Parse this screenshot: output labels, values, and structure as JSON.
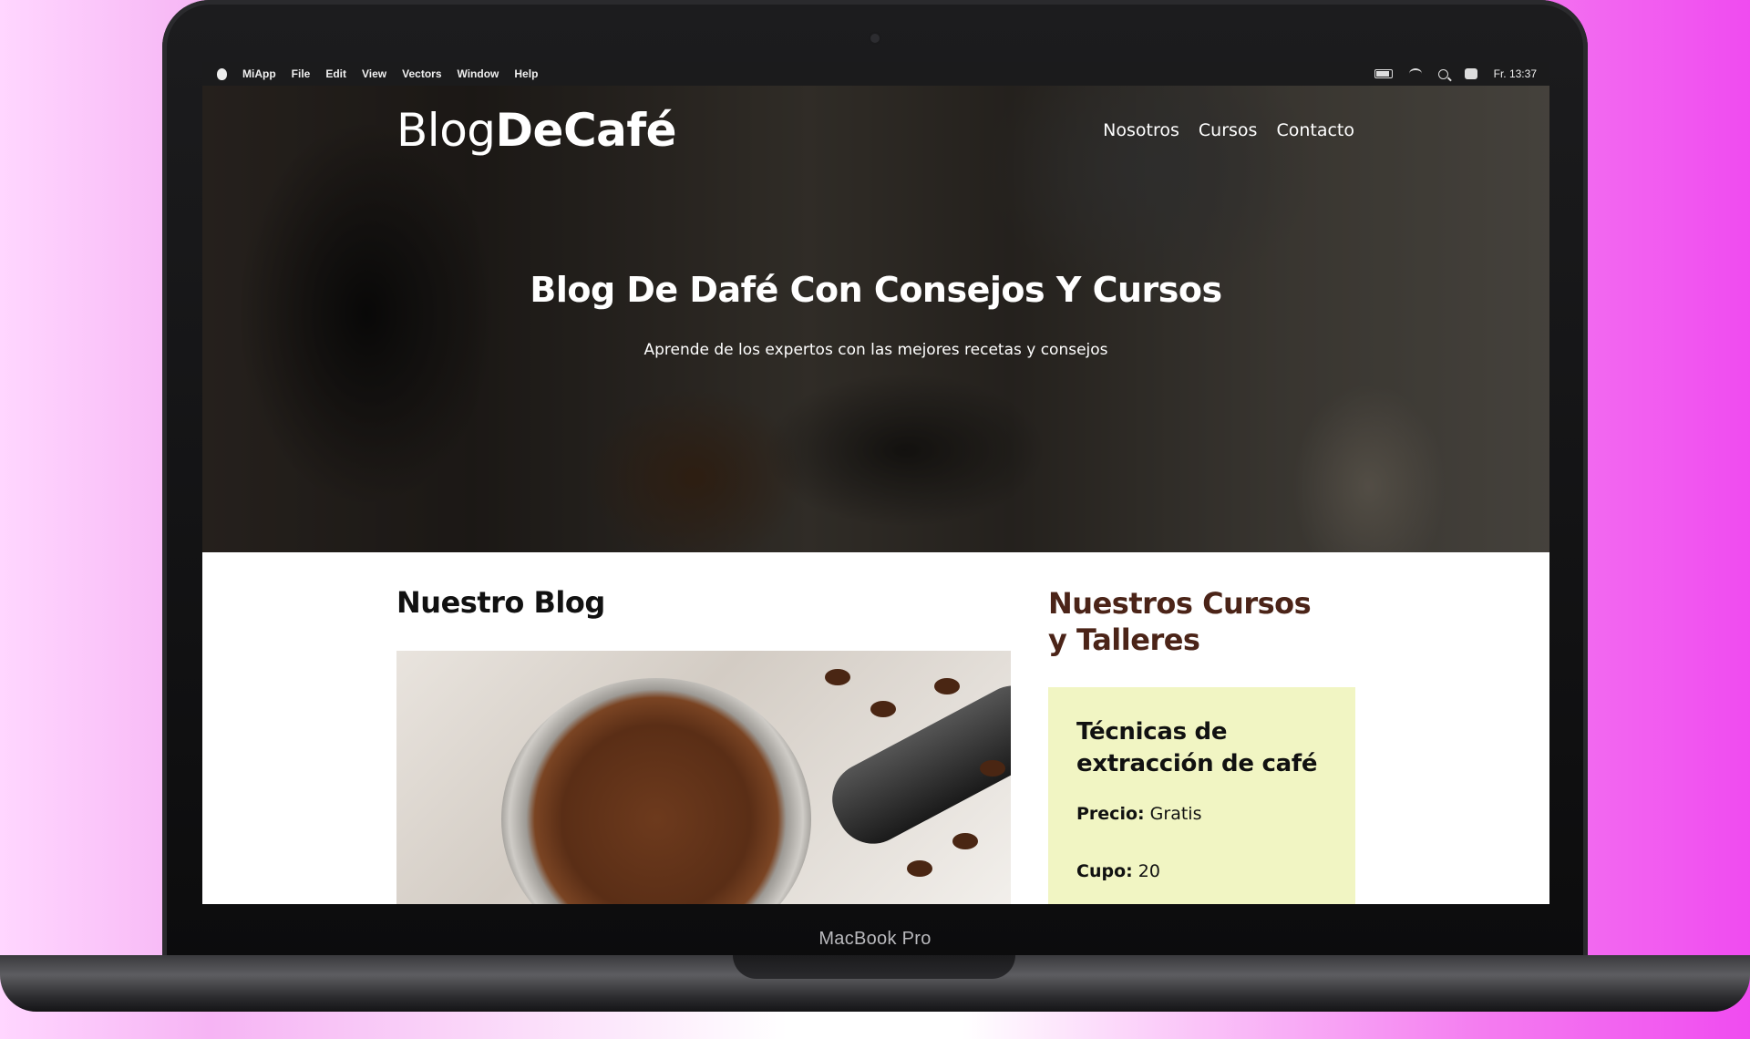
{
  "device": {
    "label": "MacBook Pro"
  },
  "menubar": {
    "app": "MiApp",
    "items": [
      "File",
      "Edit",
      "View",
      "Vectors",
      "Window",
      "Help"
    ],
    "clock": "Fr. 13:37"
  },
  "site": {
    "logo_regular": "Blog",
    "logo_bold": "DeCafé",
    "nav": [
      "Nosotros",
      "Cursos",
      "Contacto"
    ]
  },
  "hero": {
    "title": "Blog De Dafé Con Consejos Y Cursos",
    "subtitle": "Aprende de los expertos con las mejores recetas y consejos"
  },
  "blog": {
    "title": "Nuestro Blog"
  },
  "courses": {
    "title": "Nuestros Cursos y Talleres",
    "card": {
      "name": "Técnicas de extracción de café",
      "price_label": "Precio:",
      "price_value": "Gratis",
      "quota_label": "Cupo:",
      "quota_value": "20"
    }
  },
  "colors": {
    "course_title": "#4b2418",
    "card_bg": "#f1f5c3",
    "menubar_bg": "#1b1b1c"
  }
}
